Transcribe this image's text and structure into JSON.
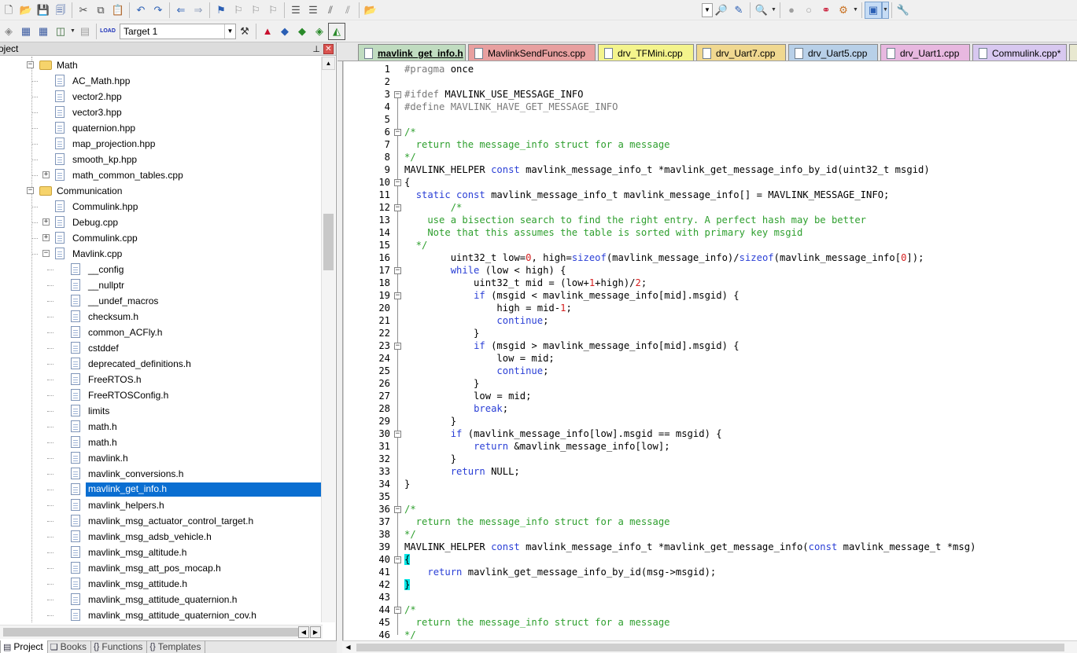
{
  "toolbar1": {
    "icons": [
      "new-file-icon",
      "open-icon",
      "save-icon",
      "save-all-icon",
      "cut-icon",
      "copy-icon",
      "paste-icon",
      "undo-icon",
      "redo-icon",
      "nav-back-icon",
      "nav-forward-icon",
      "bookmark-icon",
      "prev-bookmark-icon",
      "next-bookmark-icon",
      "clear-bookmarks-icon",
      "indent-icon",
      "unindent-icon",
      "comment-icon",
      "uncomment-icon",
      "find-in-files-icon",
      "find-icon",
      "incremental-find-icon",
      "debug-session-icon",
      "breakpoint-icon",
      "disable-breakpoint-icon",
      "kill-breakpoints-icon",
      "step-icon",
      "window-layout-icon",
      "tools-icon"
    ]
  },
  "toolbar2": {
    "load_label": "LOAD",
    "target": "Target 1"
  },
  "project_panel": {
    "title": "oject",
    "pin": "📌",
    "close": "✕",
    "tree": [
      {
        "label": "Math",
        "level": 1,
        "type": "folder",
        "exp": "−"
      },
      {
        "label": "AC_Math.hpp",
        "level": 2,
        "type": "file"
      },
      {
        "label": "vector2.hpp",
        "level": 2,
        "type": "file"
      },
      {
        "label": "vector3.hpp",
        "level": 2,
        "type": "file"
      },
      {
        "label": "quaternion.hpp",
        "level": 2,
        "type": "file"
      },
      {
        "label": "map_projection.hpp",
        "level": 2,
        "type": "file"
      },
      {
        "label": "smooth_kp.hpp",
        "level": 2,
        "type": "file"
      },
      {
        "label": "math_common_tables.cpp",
        "level": 2,
        "type": "file",
        "exp": "+"
      },
      {
        "label": "Communication",
        "level": 1,
        "type": "folder",
        "exp": "−"
      },
      {
        "label": "Commulink.hpp",
        "level": 2,
        "type": "file"
      },
      {
        "label": "Debug.cpp",
        "level": 2,
        "type": "file",
        "exp": "+"
      },
      {
        "label": "Commulink.cpp",
        "level": 2,
        "type": "file",
        "exp": "+"
      },
      {
        "label": "Mavlink.cpp",
        "level": 2,
        "type": "file",
        "exp": "−"
      },
      {
        "label": "__config",
        "level": 3,
        "type": "file"
      },
      {
        "label": "__nullptr",
        "level": 3,
        "type": "file"
      },
      {
        "label": "__undef_macros",
        "level": 3,
        "type": "file"
      },
      {
        "label": "checksum.h",
        "level": 3,
        "type": "file"
      },
      {
        "label": "common_ACFly.h",
        "level": 3,
        "type": "file"
      },
      {
        "label": "cstddef",
        "level": 3,
        "type": "file"
      },
      {
        "label": "deprecated_definitions.h",
        "level": 3,
        "type": "file"
      },
      {
        "label": "FreeRTOS.h",
        "level": 3,
        "type": "file"
      },
      {
        "label": "FreeRTOSConfig.h",
        "level": 3,
        "type": "file"
      },
      {
        "label": "limits",
        "level": 3,
        "type": "file"
      },
      {
        "label": "math.h",
        "level": 3,
        "type": "file"
      },
      {
        "label": "math.h",
        "level": 3,
        "type": "file"
      },
      {
        "label": "mavlink.h",
        "level": 3,
        "type": "file"
      },
      {
        "label": "mavlink_conversions.h",
        "level": 3,
        "type": "file"
      },
      {
        "label": "mavlink_get_info.h",
        "level": 3,
        "type": "file",
        "selected": true
      },
      {
        "label": "mavlink_helpers.h",
        "level": 3,
        "type": "file"
      },
      {
        "label": "mavlink_msg_actuator_control_target.h",
        "level": 3,
        "type": "file"
      },
      {
        "label": "mavlink_msg_adsb_vehicle.h",
        "level": 3,
        "type": "file"
      },
      {
        "label": "mavlink_msg_altitude.h",
        "level": 3,
        "type": "file"
      },
      {
        "label": "mavlink_msg_att_pos_mocap.h",
        "level": 3,
        "type": "file"
      },
      {
        "label": "mavlink_msg_attitude.h",
        "level": 3,
        "type": "file"
      },
      {
        "label": "mavlink_msg_attitude_quaternion.h",
        "level": 3,
        "type": "file"
      },
      {
        "label": "mavlink_msg_attitude_quaternion_cov.h",
        "level": 3,
        "type": "file"
      }
    ],
    "bottom_tabs": [
      {
        "label": "Project",
        "icon": "▤",
        "active": true
      },
      {
        "label": "Books",
        "icon": "❏"
      },
      {
        "label": "Functions",
        "icon": "{}"
      },
      {
        "label": "Templates",
        "icon": "{}"
      }
    ]
  },
  "editor_tabs": [
    {
      "label": "mavlink_get_info.h",
      "color": "#c0dcc0",
      "active": true
    },
    {
      "label": "MavlinkSendFuncs.cpp",
      "color": "#e8a0a0"
    },
    {
      "label": "drv_TFMini.cpp",
      "color": "#f4f48c"
    },
    {
      "label": "drv_Uart7.cpp",
      "color": "#f0d890"
    },
    {
      "label": "drv_Uart5.cpp",
      "color": "#b8d0e8"
    },
    {
      "label": "drv_Uart1.cpp",
      "color": "#e8b8e0"
    },
    {
      "label": "Commulink.cpp*",
      "color": "#d8c8f0"
    }
  ],
  "code_lines": [
    {
      "n": "1",
      "code": [
        [
          "pp",
          "#pragma"
        ],
        [
          "",
          "once"
        ]
      ]
    },
    {
      "n": "2",
      "code": []
    },
    {
      "n": "3",
      "fold": "−",
      "code": [
        [
          "pp",
          "#ifdef"
        ],
        [
          "",
          " MAVLINK_USE_MESSAGE_INFO"
        ]
      ]
    },
    {
      "n": "4",
      "code": [
        [
          "pp",
          "#define MAVLINK_HAVE_GET_MESSAGE_INFO"
        ]
      ]
    },
    {
      "n": "5",
      "code": []
    },
    {
      "n": "6",
      "fold": "−",
      "code": [
        [
          "cm",
          "/*"
        ]
      ]
    },
    {
      "n": "7",
      "code": [
        [
          "cm",
          "  return the message_info struct for a message"
        ]
      ]
    },
    {
      "n": "8",
      "code": [
        [
          "cm",
          "*/"
        ]
      ]
    },
    {
      "n": "9",
      "code": [
        [
          "",
          "MAVLINK_HELPER "
        ],
        [
          "kw",
          "const"
        ],
        [
          "",
          " mavlink_message_info_t *mavlink_get_message_info_by_id(uint32_t msgid)"
        ]
      ]
    },
    {
      "n": "10",
      "fold": "−",
      "code": [
        [
          "",
          "{"
        ]
      ]
    },
    {
      "n": "11",
      "code": [
        [
          "",
          "  "
        ],
        [
          "kw",
          "static const"
        ],
        [
          "",
          " mavlink_message_info_t mavlink_message_info[] = MAVLINK_MESSAGE_INFO;"
        ]
      ]
    },
    {
      "n": "12",
      "fold": "−",
      "code": [
        [
          "cm",
          "        /*"
        ]
      ]
    },
    {
      "n": "13",
      "code": [
        [
          "cm",
          "    use a bisection search to find the right entry. A perfect hash may be better"
        ]
      ]
    },
    {
      "n": "14",
      "code": [
        [
          "cm",
          "    Note that this assumes the table is sorted with primary key msgid"
        ]
      ]
    },
    {
      "n": "15",
      "code": [
        [
          "cm",
          "  */"
        ]
      ]
    },
    {
      "n": "16",
      "code": [
        [
          "",
          "        uint32_t low="
        ],
        [
          "num",
          "0"
        ],
        [
          "",
          ", high="
        ],
        [
          "kw",
          "sizeof"
        ],
        [
          "",
          "(mavlink_message_info)/"
        ],
        [
          "kw",
          "sizeof"
        ],
        [
          "",
          "(mavlink_message_info["
        ],
        [
          "num",
          "0"
        ],
        [
          "",
          "]);"
        ]
      ]
    },
    {
      "n": "17",
      "fold": "−",
      "code": [
        [
          "",
          "        "
        ],
        [
          "kw",
          "while"
        ],
        [
          "",
          " (low < high) {"
        ]
      ]
    },
    {
      "n": "18",
      "code": [
        [
          "",
          "            uint32_t mid = (low+"
        ],
        [
          "num",
          "1"
        ],
        [
          "",
          "+high)/"
        ],
        [
          "num",
          "2"
        ],
        [
          "",
          ";"
        ]
      ]
    },
    {
      "n": "19",
      "fold": "−",
      "code": [
        [
          "",
          "            "
        ],
        [
          "kw",
          "if"
        ],
        [
          "",
          " (msgid < mavlink_message_info[mid].msgid) {"
        ]
      ]
    },
    {
      "n": "20",
      "code": [
        [
          "",
          "                high = mid-"
        ],
        [
          "num",
          "1"
        ],
        [
          "",
          ";"
        ]
      ]
    },
    {
      "n": "21",
      "code": [
        [
          "",
          "                "
        ],
        [
          "kw",
          "continue"
        ],
        [
          "",
          ";"
        ]
      ]
    },
    {
      "n": "22",
      "code": [
        [
          "",
          "            }"
        ]
      ]
    },
    {
      "n": "23",
      "fold": "−",
      "code": [
        [
          "",
          "            "
        ],
        [
          "kw",
          "if"
        ],
        [
          "",
          " (msgid > mavlink_message_info[mid].msgid) {"
        ]
      ]
    },
    {
      "n": "24",
      "code": [
        [
          "",
          "                low = mid;"
        ]
      ]
    },
    {
      "n": "25",
      "code": [
        [
          "",
          "                "
        ],
        [
          "kw",
          "continue"
        ],
        [
          "",
          ";"
        ]
      ]
    },
    {
      "n": "26",
      "code": [
        [
          "",
          "            }"
        ]
      ]
    },
    {
      "n": "27",
      "code": [
        [
          "",
          "            low = mid;"
        ]
      ]
    },
    {
      "n": "28",
      "code": [
        [
          "",
          "            "
        ],
        [
          "kw",
          "break"
        ],
        [
          "",
          ";"
        ]
      ]
    },
    {
      "n": "29",
      "code": [
        [
          "",
          "        }"
        ]
      ]
    },
    {
      "n": "30",
      "fold": "−",
      "code": [
        [
          "",
          "        "
        ],
        [
          "kw",
          "if"
        ],
        [
          "",
          " (mavlink_message_info[low].msgid == msgid) {"
        ]
      ]
    },
    {
      "n": "31",
      "code": [
        [
          "",
          "            "
        ],
        [
          "kw",
          "return"
        ],
        [
          "",
          " &mavlink_message_info[low];"
        ]
      ]
    },
    {
      "n": "32",
      "code": [
        [
          "",
          "        }"
        ]
      ]
    },
    {
      "n": "33",
      "code": [
        [
          "",
          "        "
        ],
        [
          "kw",
          "return"
        ],
        [
          "",
          " NULL;"
        ]
      ]
    },
    {
      "n": "34",
      "code": [
        [
          "",
          "}"
        ]
      ]
    },
    {
      "n": "35",
      "code": []
    },
    {
      "n": "36",
      "fold": "−",
      "code": [
        [
          "cm",
          "/*"
        ]
      ]
    },
    {
      "n": "37",
      "code": [
        [
          "cm",
          "  return the message_info struct for a message"
        ]
      ]
    },
    {
      "n": "38",
      "code": [
        [
          "cm",
          "*/"
        ]
      ]
    },
    {
      "n": "39",
      "code": [
        [
          "",
          "MAVLINK_HELPER "
        ],
        [
          "kw",
          "const"
        ],
        [
          "",
          " mavlink_message_info_t *mavlink_get_message_info("
        ],
        [
          "kw",
          "const"
        ],
        [
          "",
          " mavlink_message_t *msg)"
        ]
      ]
    },
    {
      "n": "40",
      "fold": "−",
      "code": [
        [
          "hl",
          "{"
        ]
      ]
    },
    {
      "n": "41",
      "code": [
        [
          "",
          "    "
        ],
        [
          "kw",
          "return"
        ],
        [
          "",
          " mavlink_get_message_info_by_id(msg->msgid);"
        ]
      ]
    },
    {
      "n": "42",
      "code": [
        [
          "hl",
          "}"
        ]
      ]
    },
    {
      "n": "43",
      "code": []
    },
    {
      "n": "44",
      "fold": "−",
      "code": [
        [
          "cm",
          "/*"
        ]
      ]
    },
    {
      "n": "45",
      "code": [
        [
          "cm",
          "  return the message_info struct for a message"
        ]
      ]
    },
    {
      "n": "46",
      "code": [
        [
          "cm",
          "*/"
        ]
      ]
    }
  ]
}
